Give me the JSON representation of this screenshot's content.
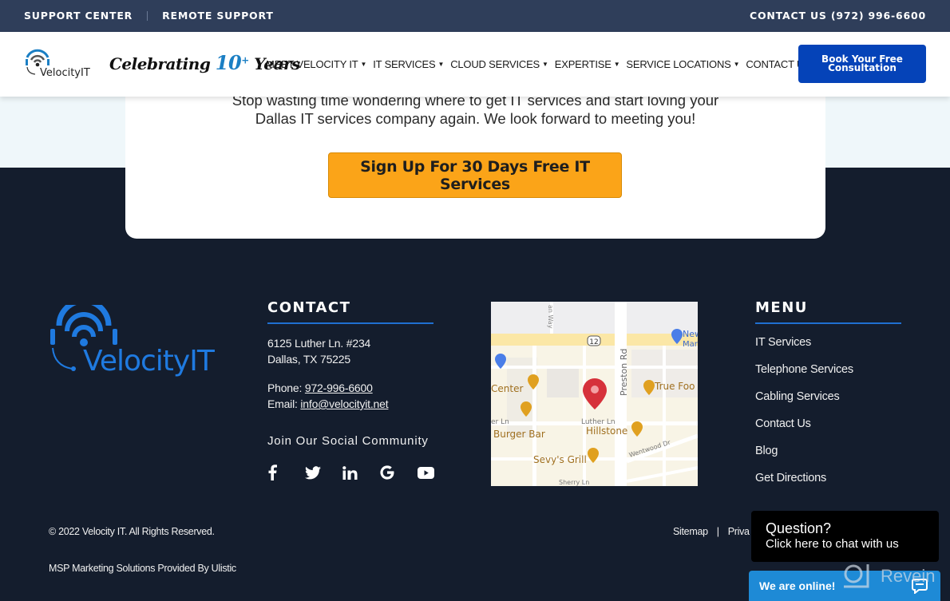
{
  "topbar": {
    "support_center": "SUPPORT CENTER",
    "remote_support": "REMOTE SUPPORT",
    "contact": "CONTACT US (972) 996-6600"
  },
  "header": {
    "logo_text": "VelocityIT",
    "celebrating_prefix": "Celebrating",
    "celebrating_number": "10",
    "celebrating_plus": "+",
    "celebrating_suffix": "Years",
    "nav": [
      {
        "label": "MEET VELOCITY IT",
        "dropdown": true
      },
      {
        "label": "IT SERVICES",
        "dropdown": true
      },
      {
        "label": "CLOUD SERVICES",
        "dropdown": true
      },
      {
        "label": "EXPERTISE",
        "dropdown": true
      },
      {
        "label": "SERVICE LOCATIONS",
        "dropdown": true
      },
      {
        "label": "CONTACT US",
        "dropdown": false
      }
    ],
    "cta_line1": "Book Your Free",
    "cta_line2": "Consultation"
  },
  "hero": {
    "text_line1": "Stop wasting time wondering where to get IT services and start loving your",
    "text_line2": "Dallas IT services company again. We look forward to meeting you!",
    "signup_button": "Sign Up For 30 Days Free IT Services"
  },
  "footer": {
    "logo_text": "VelocityIT",
    "contact": {
      "title": "CONTACT",
      "address_line1": "6125 Luther Ln. #234",
      "address_line2": "Dallas, TX 75225",
      "phone_label": "Phone: ",
      "phone": "972-996-6600",
      "email_label": "Email: ",
      "email": "info@velocityit.net",
      "social_title": "Join Our Social Community",
      "social": [
        "facebook",
        "twitter",
        "linkedin",
        "google",
        "youtube"
      ]
    },
    "map": {
      "labels": {
        "way": "an Way",
        "route": "12",
        "preston": "Preston Rd",
        "new_market": "New",
        "new_market2": "Mar",
        "center": "Center",
        "true_food": "True Foo",
        "luther_left": "er Ln",
        "luther": "Luther Ln",
        "burger_bar": "Burger Bar",
        "hillstone": "Hillstone",
        "wentwood": "Wentwood Dr",
        "sevys": "Sevy's Grill",
        "sherry": "Sherry Ln"
      }
    },
    "menu": {
      "title": "MENU",
      "items": [
        "IT Services",
        "Telephone Services",
        "Cabling Services",
        "Contact Us",
        "Blog",
        "Get Directions"
      ]
    },
    "copyright": "© 2022 Velocity IT. All Rights Reserved.",
    "msp": "MSP Marketing Solutions Provided By Ulistic",
    "bottom_links": [
      "Sitemap",
      "|",
      "Priva"
    ]
  },
  "chat": {
    "question": "Question?",
    "cta": "Click here to chat with us",
    "online": "We are online!",
    "watermark": "Revein"
  },
  "colors": {
    "topbar": "#2f3e5a",
    "brand_blue": "#0543b8",
    "accent_orange": "#fba418",
    "footer_bg": "#141d2d",
    "logo_blue": "#1f7ae0",
    "chat_blue": "#1e8ad6"
  }
}
